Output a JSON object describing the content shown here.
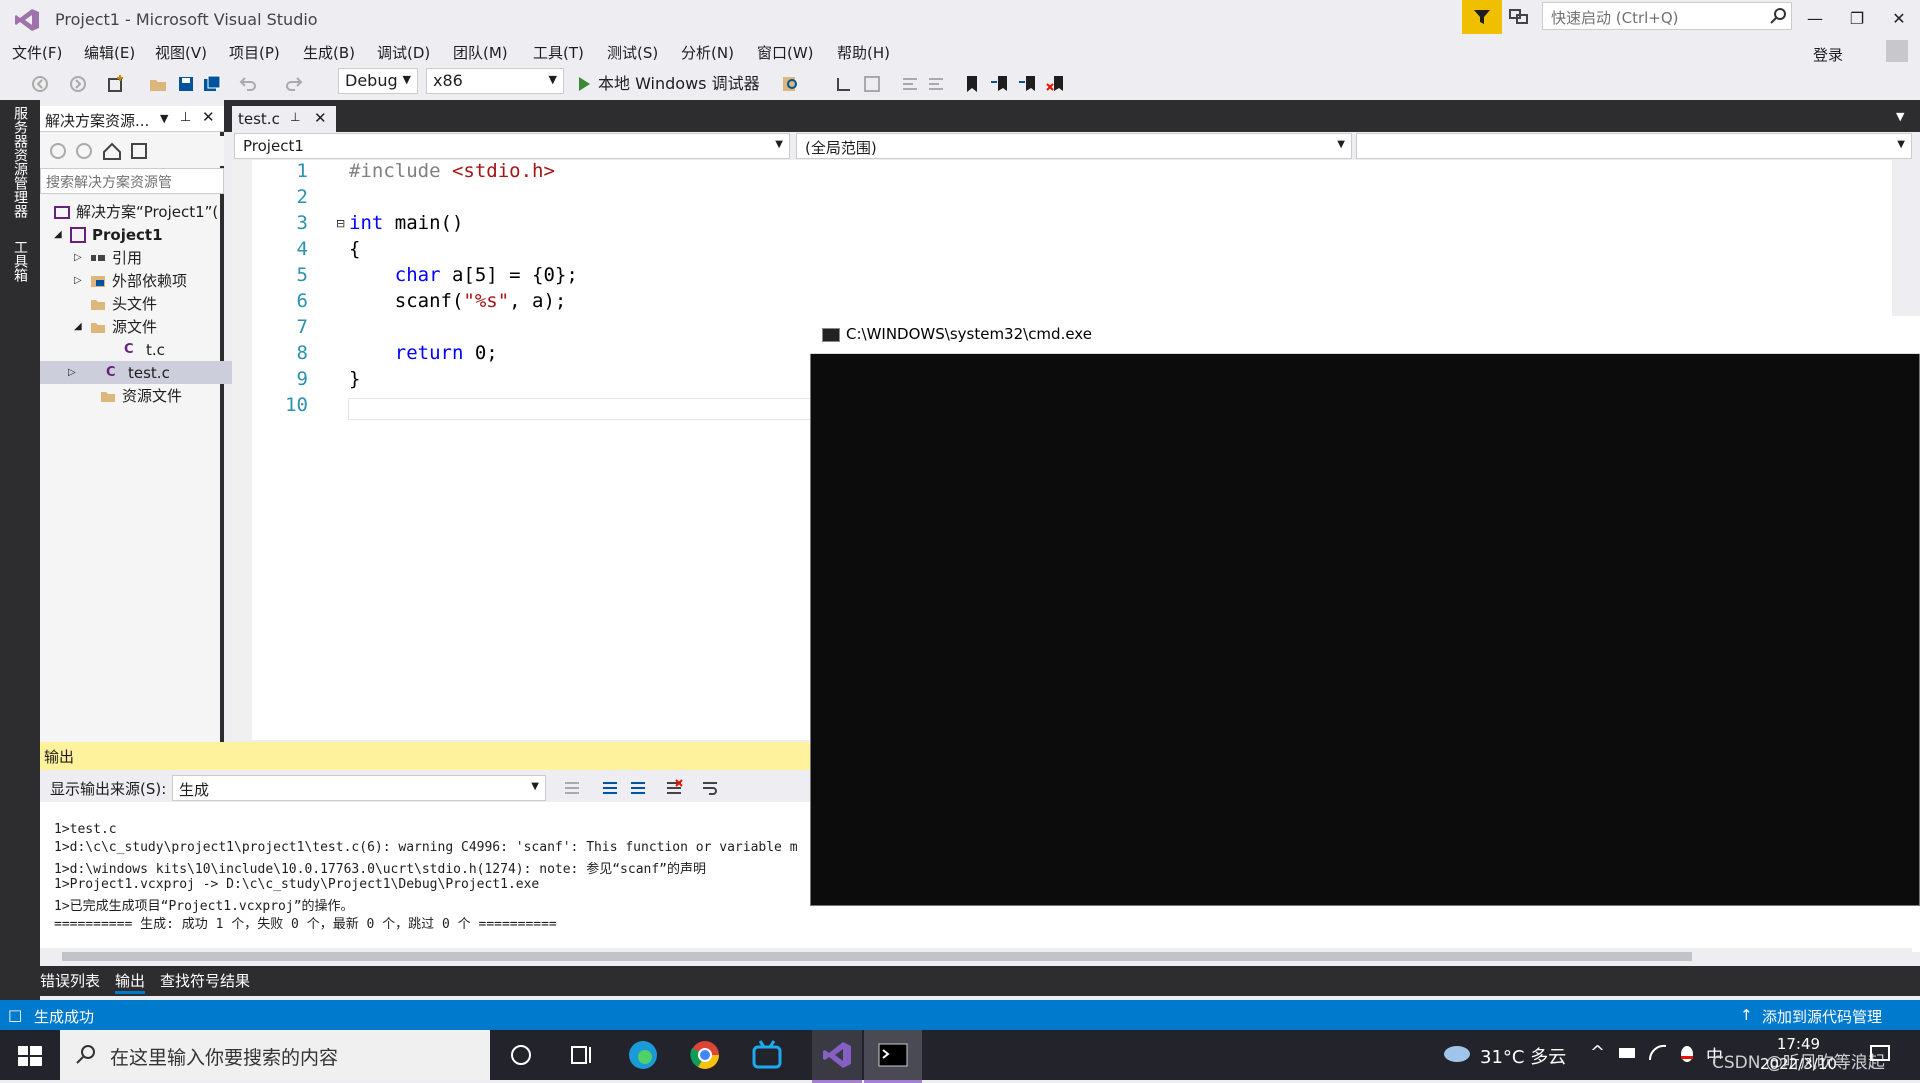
{
  "window": {
    "title": "Project1 - Microsoft Visual Studio",
    "quick_launch_placeholder": "快速启动 (Ctrl+Q)",
    "signin": "登录"
  },
  "menu": [
    "文件(F)",
    "编辑(E)",
    "视图(V)",
    "项目(P)",
    "生成(B)",
    "调试(D)",
    "团队(M)",
    "工具(T)",
    "测试(S)",
    "分析(N)",
    "窗口(W)",
    "帮助(H)"
  ],
  "toolbar": {
    "config": "Debug",
    "platform": "x86",
    "run_label": "本地 Windows 调试器"
  },
  "side_tabs": [
    "服务器资源管理器",
    "工具箱"
  ],
  "solution_explorer": {
    "title": "解决方案资源...",
    "search_placeholder": "搜索解决方案资源管",
    "items": [
      {
        "label": "解决方案“Project1”(",
        "icon": "solution-icon"
      },
      {
        "label": "Project1",
        "icon": "project-icon"
      },
      {
        "label": "引用",
        "icon": "references-icon"
      },
      {
        "label": "外部依赖项",
        "icon": "external-deps-icon"
      },
      {
        "label": "头文件",
        "icon": "folder-icon"
      },
      {
        "label": "源文件",
        "icon": "folder-icon"
      },
      {
        "label": "t.c",
        "icon": "c-file-icon"
      },
      {
        "label": "test.c",
        "icon": "c-file-icon"
      },
      {
        "label": "资源文件",
        "icon": "folder-icon"
      }
    ]
  },
  "editor": {
    "tab": "test.c",
    "nav_project": "Project1",
    "nav_scope": "(全局范围)",
    "line_numbers": [
      "1",
      "2",
      "3",
      "4",
      "5",
      "6",
      "7",
      "8",
      "9",
      "10"
    ]
  },
  "cmd": {
    "title": "C:\\WINDOWS\\system32\\cmd.exe"
  },
  "output": {
    "title": "输出",
    "source_label": "显示输出来源(S):",
    "source_value": "生成",
    "lines": [
      "1>test.c",
      "1>d:\\c\\c_study\\project1\\project1\\test.c(6): warning C4996: 'scanf': This function or variable m",
      "1>d:\\windows kits\\10\\include\\10.0.17763.0\\ucrt\\stdio.h(1274): note: 参见“scanf”的声明",
      "1>Project1.vcxproj -> D:\\c\\c_study\\Project1\\Debug\\Project1.exe",
      "1>已完成生成项目“Project1.vcxproj”的操作。",
      "========== 生成: 成功 1 个，失败 0 个，最新 0 个，跳过 0 个 =========="
    ]
  },
  "bottom_tabs": [
    "错误列表",
    "输出",
    "查找符号结果"
  ],
  "status": {
    "left": "生成成功",
    "right": "添加到源代码管理"
  },
  "taskbar": {
    "search_placeholder": "在这里输入你要搜索的内容",
    "weather": "31°C  多云",
    "time": "17:49",
    "date": "2022/3/10",
    "watermark": "CSDN @听风吹等浪起"
  }
}
